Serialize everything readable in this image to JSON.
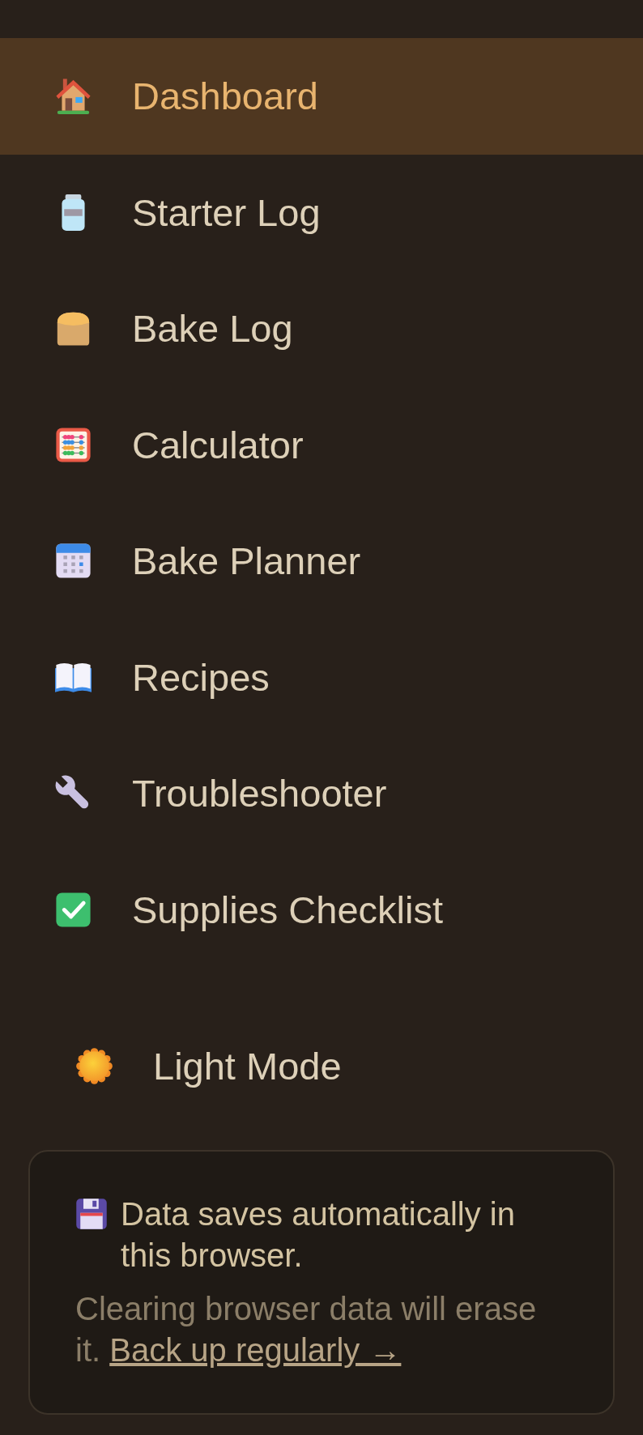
{
  "nav": {
    "items": [
      {
        "label": "Dashboard",
        "selected": true
      },
      {
        "label": "Starter Log",
        "selected": false
      },
      {
        "label": "Bake Log",
        "selected": false
      },
      {
        "label": "Calculator",
        "selected": false
      },
      {
        "label": "Bake Planner",
        "selected": false
      },
      {
        "label": "Recipes",
        "selected": false
      },
      {
        "label": "Troubleshooter",
        "selected": false
      },
      {
        "label": "Supplies Checklist",
        "selected": false
      }
    ]
  },
  "theme_toggle": {
    "label": "Light Mode"
  },
  "storage_notice": {
    "message": "Data saves automatically in this browser.",
    "note": "Clearing browser data will erase it.",
    "link": "Back up regularly →"
  }
}
